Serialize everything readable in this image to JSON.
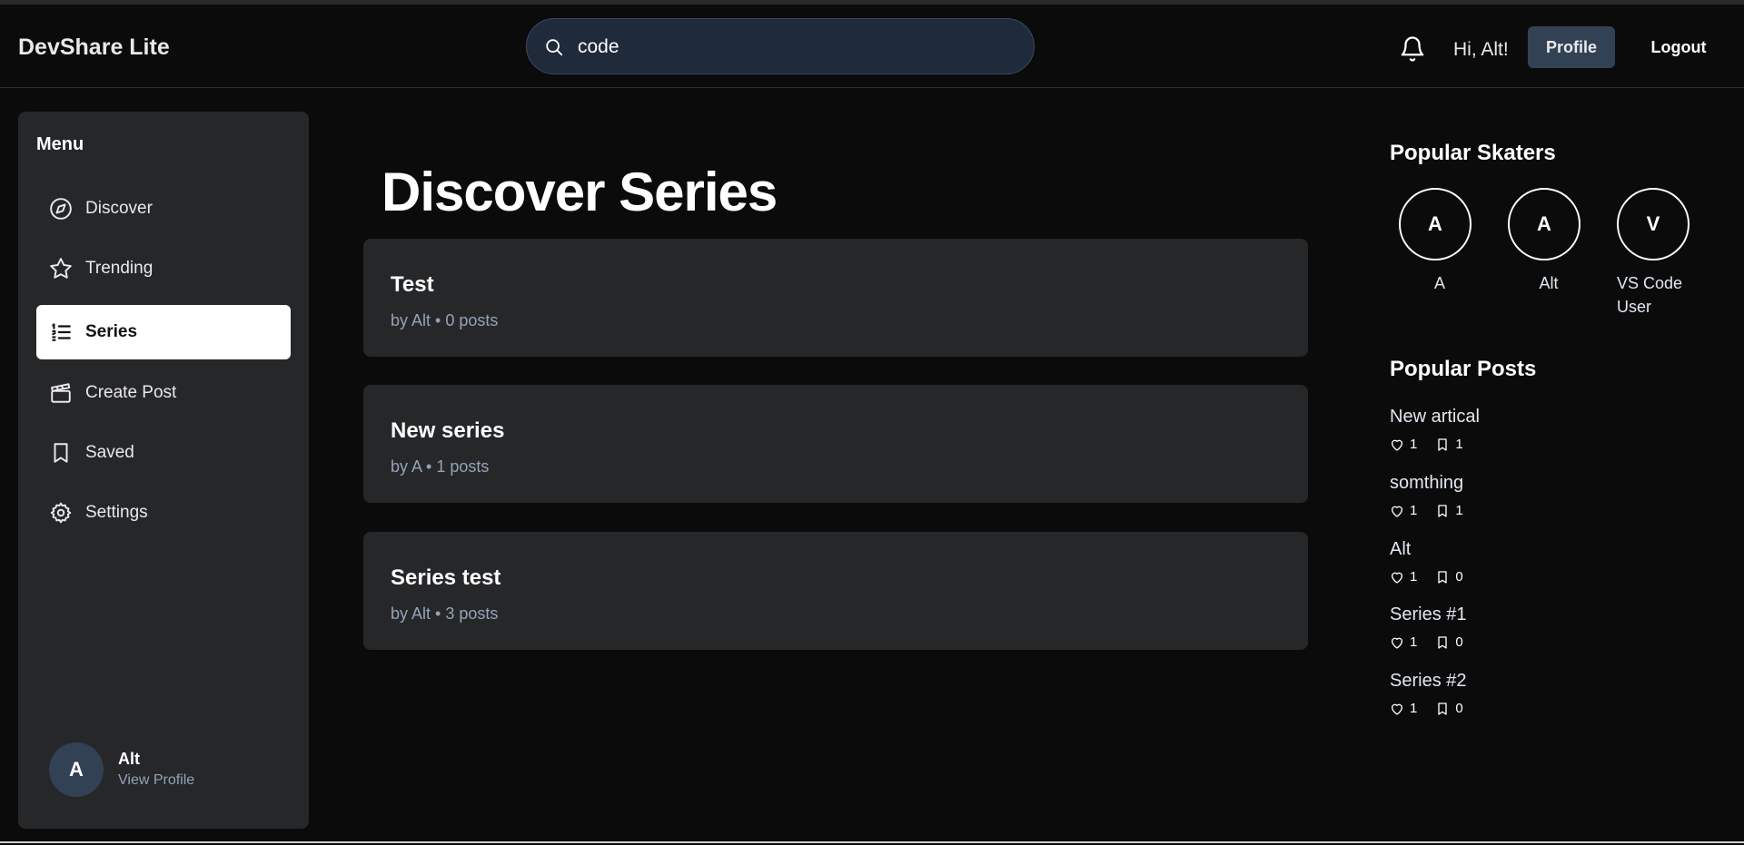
{
  "header": {
    "brand": "DevShare Lite",
    "search_value": "code",
    "greeting": "Hi, Alt!",
    "profile_label": "Profile",
    "logout_label": "Logout"
  },
  "sidebar": {
    "title": "Menu",
    "items": [
      {
        "label": "Discover",
        "icon": "compass-icon"
      },
      {
        "label": "Trending",
        "icon": "star-icon"
      },
      {
        "label": "Series",
        "icon": "list-ordered-icon",
        "active": true
      },
      {
        "label": "Create Post",
        "icon": "clapperboard-icon"
      },
      {
        "label": "Saved",
        "icon": "bookmark-icon"
      },
      {
        "label": "Settings",
        "icon": "gear-icon"
      }
    ],
    "user": {
      "initial": "A",
      "name": "Alt",
      "link": "View Profile"
    }
  },
  "main": {
    "title": "Discover Series",
    "series": [
      {
        "title": "Test",
        "meta": "by Alt • 0 posts"
      },
      {
        "title": "New series",
        "meta": "by A • 1 posts"
      },
      {
        "title": "Series test",
        "meta": "by Alt • 3 posts"
      }
    ]
  },
  "rail": {
    "skaters_title": "Popular Skaters",
    "skaters": [
      {
        "initial": "A",
        "name": "A"
      },
      {
        "initial": "A",
        "name": "Alt"
      },
      {
        "initial": "V",
        "name": "VS Code User"
      }
    ],
    "posts_title": "Popular Posts",
    "posts": [
      {
        "title": "New artical",
        "likes": "1",
        "saves": "1"
      },
      {
        "title": "somthing",
        "likes": "1",
        "saves": "1"
      },
      {
        "title": "Alt",
        "likes": "1",
        "saves": "0"
      },
      {
        "title": "Series #1",
        "likes": "1",
        "saves": "0"
      },
      {
        "title": "Series #2",
        "likes": "1",
        "saves": "0"
      }
    ]
  },
  "colors": {
    "background": "#0b0b0b",
    "panel": "#262729",
    "accent_button": "#334155",
    "muted_text": "#94a3b8"
  }
}
